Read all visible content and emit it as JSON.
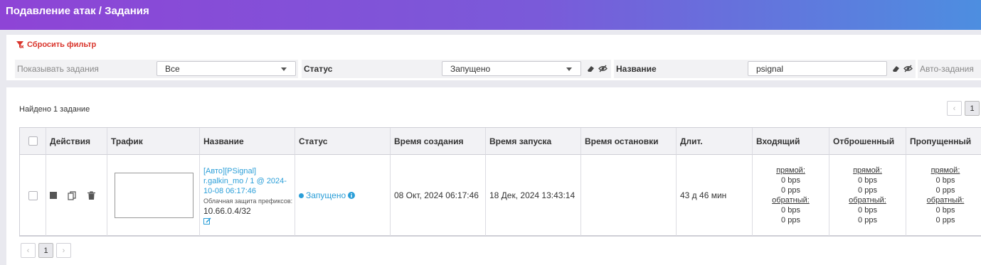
{
  "header": {
    "title": "Подавление атак / Задания"
  },
  "filters": {
    "reset_label": "Сбросить фильтр",
    "show_tasks_label": "Показывать задания",
    "show_tasks_value": "Все",
    "status_label": "Статус",
    "status_value": "Запущено",
    "name_label": "Название",
    "name_value": "psignal",
    "auto_tasks_label": "Авто-задания"
  },
  "results": {
    "found_text": "Найдено 1 задание",
    "current_page": "1",
    "prev_symbol": "‹",
    "next_symbol": "›"
  },
  "table": {
    "columns": [
      "Действия",
      "Трафик",
      "Название",
      "Статус",
      "Время создания",
      "Время запуска",
      "Время остановки",
      "Длит.",
      "Входящий",
      "Отброшенный",
      "Пропущенный"
    ],
    "rows": [
      {
        "name_link": "[Авто][PSignal] r.galkin_mo / 1 @ 2024-10-08 06:17:46",
        "protection_label": "Облачная защита префиксов:",
        "prefix": "10.66.0.4/32",
        "status": "Запущено",
        "created": "08 Окт, 2024  06:17:46",
        "started": "18 Дек, 2024  13:43:14",
        "stopped": "",
        "duration": "43 д 46 мин",
        "incoming": {
          "direct_label": "прямой:",
          "direct_bps": "0 bps",
          "direct_pps": "0 pps",
          "reverse_label": "обратный:",
          "reverse_bps": "0 bps",
          "reverse_pps": "0 pps"
        },
        "dropped": {
          "direct_label": "прямой:",
          "direct_bps": "0 bps",
          "direct_pps": "0 pps",
          "reverse_label": "обратный:",
          "reverse_bps": "0 bps",
          "reverse_pps": "0 pps"
        },
        "passed": {
          "direct_label": "прямой:",
          "direct_bps": "0 bps",
          "direct_pps": "0 pps",
          "reverse_label": "обратный:",
          "reverse_bps": "0 bps",
          "reverse_pps": "0 pps"
        }
      }
    ]
  },
  "colors": {
    "accent": "#2a9ed8",
    "danger": "#d9342b",
    "header_start": "#8e44d6",
    "header_end": "#4d8ee0"
  },
  "icons": [
    "filter-reset-icon",
    "caret-down-icon",
    "eraser-icon",
    "eye-slash-icon",
    "stop-icon",
    "copy-icon",
    "trash-icon",
    "info-icon",
    "edit-icon",
    "status-dot-icon"
  ]
}
